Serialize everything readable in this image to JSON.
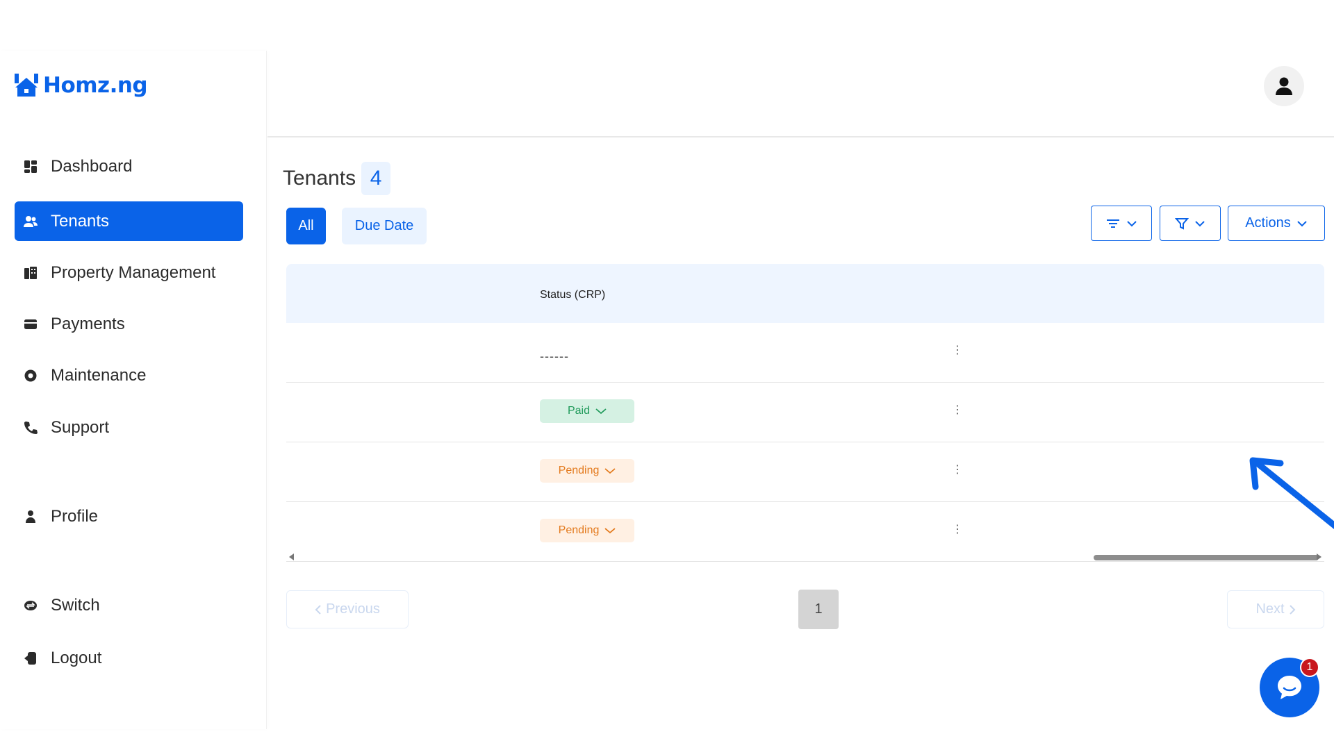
{
  "brand": {
    "name": "Homz.ng",
    "color": "#0a63e8"
  },
  "sidebar": {
    "items": [
      {
        "label": "Dashboard",
        "icon": "dashboard-icon"
      },
      {
        "label": "Tenants",
        "icon": "users-icon",
        "active": true
      },
      {
        "label": "Property Management",
        "icon": "building-icon"
      },
      {
        "label": "Payments",
        "icon": "wallet-icon"
      },
      {
        "label": "Maintenance",
        "icon": "gear-icon"
      },
      {
        "label": "Support",
        "icon": "phone-icon"
      },
      {
        "label": "Profile",
        "icon": "person-icon"
      },
      {
        "label": "Switch",
        "icon": "switch-icon"
      },
      {
        "label": "Logout",
        "icon": "logout-icon"
      }
    ]
  },
  "header": {
    "avatar_icon": "user-avatar-icon"
  },
  "page": {
    "title": "Tenants",
    "count": "4",
    "tabs": [
      "All",
      "Due Date"
    ],
    "toolbar": {
      "actions_label": "Actions"
    }
  },
  "table": {
    "columns": [
      "Status (CRP)"
    ],
    "rows": [
      {
        "status": "------"
      },
      {
        "status": "Paid"
      },
      {
        "status": "Pending"
      },
      {
        "status": "Pending"
      }
    ]
  },
  "pagination": {
    "previous": "Previous",
    "current": "1",
    "next": "Next"
  },
  "chat": {
    "badge": "1"
  },
  "colors": {
    "paid": "#1f9a5a",
    "pending": "#e37a1d",
    "accent": "#0a63e8"
  }
}
